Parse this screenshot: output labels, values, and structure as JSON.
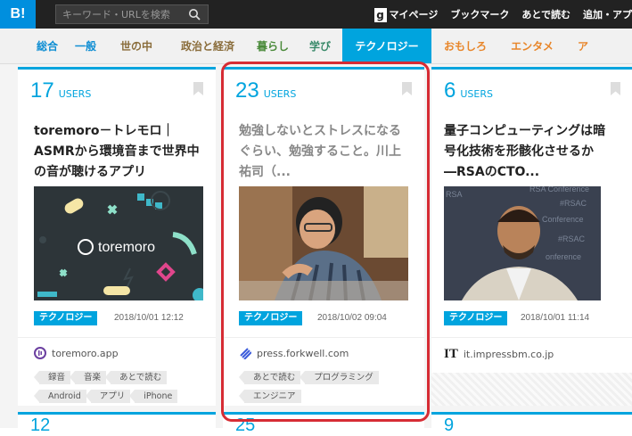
{
  "header": {
    "logo": "B!",
    "search_placeholder": "キーワード・URLを検索",
    "nav": [
      "マイページ",
      "ブックマーク",
      "あとで読む",
      "追加・アプ"
    ],
    "g_icon": "g"
  },
  "tabs": [
    {
      "label": "総合",
      "color": "#0f8ed3"
    },
    {
      "label": "一般",
      "color": "#0f8ed3"
    },
    {
      "label": "世の中",
      "color": "#8a6d3b"
    },
    {
      "label": "政治と経済",
      "color": "#8a6d3b"
    },
    {
      "label": "暮らし",
      "color": "#4a8a3a"
    },
    {
      "label": "学び",
      "color": "#3a8a6a"
    },
    {
      "label": "テクノロジー",
      "color": "#ffffff",
      "active": true
    },
    {
      "label": "おもしろ",
      "color": "#e8862a"
    },
    {
      "label": "エンタメ",
      "color": "#e8862a"
    },
    {
      "label": "ア",
      "color": "#e8862a"
    }
  ],
  "colors": {
    "accent": "#00a4de",
    "highlight": "#d62c34"
  },
  "cards": [
    {
      "users": "17",
      "users_label": "USERS",
      "title": "toremoro－トレモロ｜ASMRから環境音まで世界中の音が聴けるアプリ",
      "thumb_text": "toremoro",
      "category": "テクノロジー",
      "date": "2018/10/01 12:12",
      "site": "toremoro.app",
      "tags": [
        "録音",
        "音楽",
        "あとで読む",
        "Android",
        "アプリ",
        "iPhone"
      ]
    },
    {
      "users": "23",
      "users_label": "USERS",
      "title": "勉強しないとストレスになるぐらい、勉強すること。川上祐司（...",
      "category": "テクノロジー",
      "date": "2018/10/02 09:04",
      "site": "press.forkwell.com",
      "tags": [
        "あとで読む",
        "プログラミング",
        "エンジニア"
      ]
    },
    {
      "users": "6",
      "users_label": "USERS",
      "title": "量子コンピューティングは暗号化技術を形骸化させるか―RSAのCTO...",
      "category": "テクノロジー",
      "date": "2018/10/01 11:14",
      "site_logo": "IT",
      "site": "it.impressbm.co.jp"
    }
  ],
  "row2_counts": [
    "12",
    "25",
    "9"
  ]
}
